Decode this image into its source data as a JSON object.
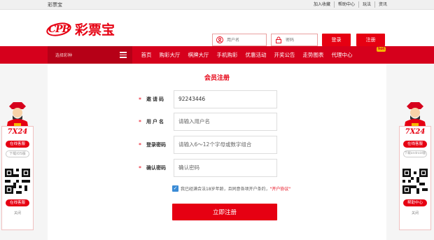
{
  "topbar": {
    "site_name": "彩票宝",
    "links": [
      "加入收藏",
      "帮助中心",
      "玩法",
      "资讯"
    ]
  },
  "header": {
    "logo_letters": "CPB",
    "logo_name": "彩票宝",
    "username_placeholder": "用户名",
    "password_placeholder": "密码",
    "login_label": "登录",
    "register_label": "注册"
  },
  "nav": {
    "select_label": "选择彩种",
    "items": [
      "首页",
      "购彩大厅",
      "棋牌大厅",
      "手机购彩",
      "优惠活动",
      "开奖公告",
      "走势图表",
      "代理中心"
    ],
    "hot_badge": "hot"
  },
  "form": {
    "title": "会员注册",
    "invite": {
      "label": "邀请码",
      "value": "92243446"
    },
    "username": {
      "label": "用户名",
      "placeholder": "请输入用户名"
    },
    "password": {
      "label": "登录密码",
      "placeholder": "请输入6～12个字母或数字组合"
    },
    "confirm": {
      "label": "确认密码",
      "placeholder": "确认密码"
    },
    "agree_text": "我已经满合法18岁年龄，且同意各项开户条约，",
    "agree_link": "\"开户协议\"",
    "submit_label": "立即注册"
  },
  "side_left": {
    "hours": "7X24",
    "service_top": "在线客服",
    "download": "下载iOS版",
    "service_bottom": "在线客服",
    "close": "关闭"
  },
  "side_right": {
    "hours": "7X24",
    "service_top": "在线客服",
    "download": "下载android版",
    "service_bottom": "帮助中心",
    "close": "关闭"
  },
  "colors": {
    "brand": "#e60012",
    "nav": "#d6001c",
    "nav_dark": "#b60017"
  }
}
